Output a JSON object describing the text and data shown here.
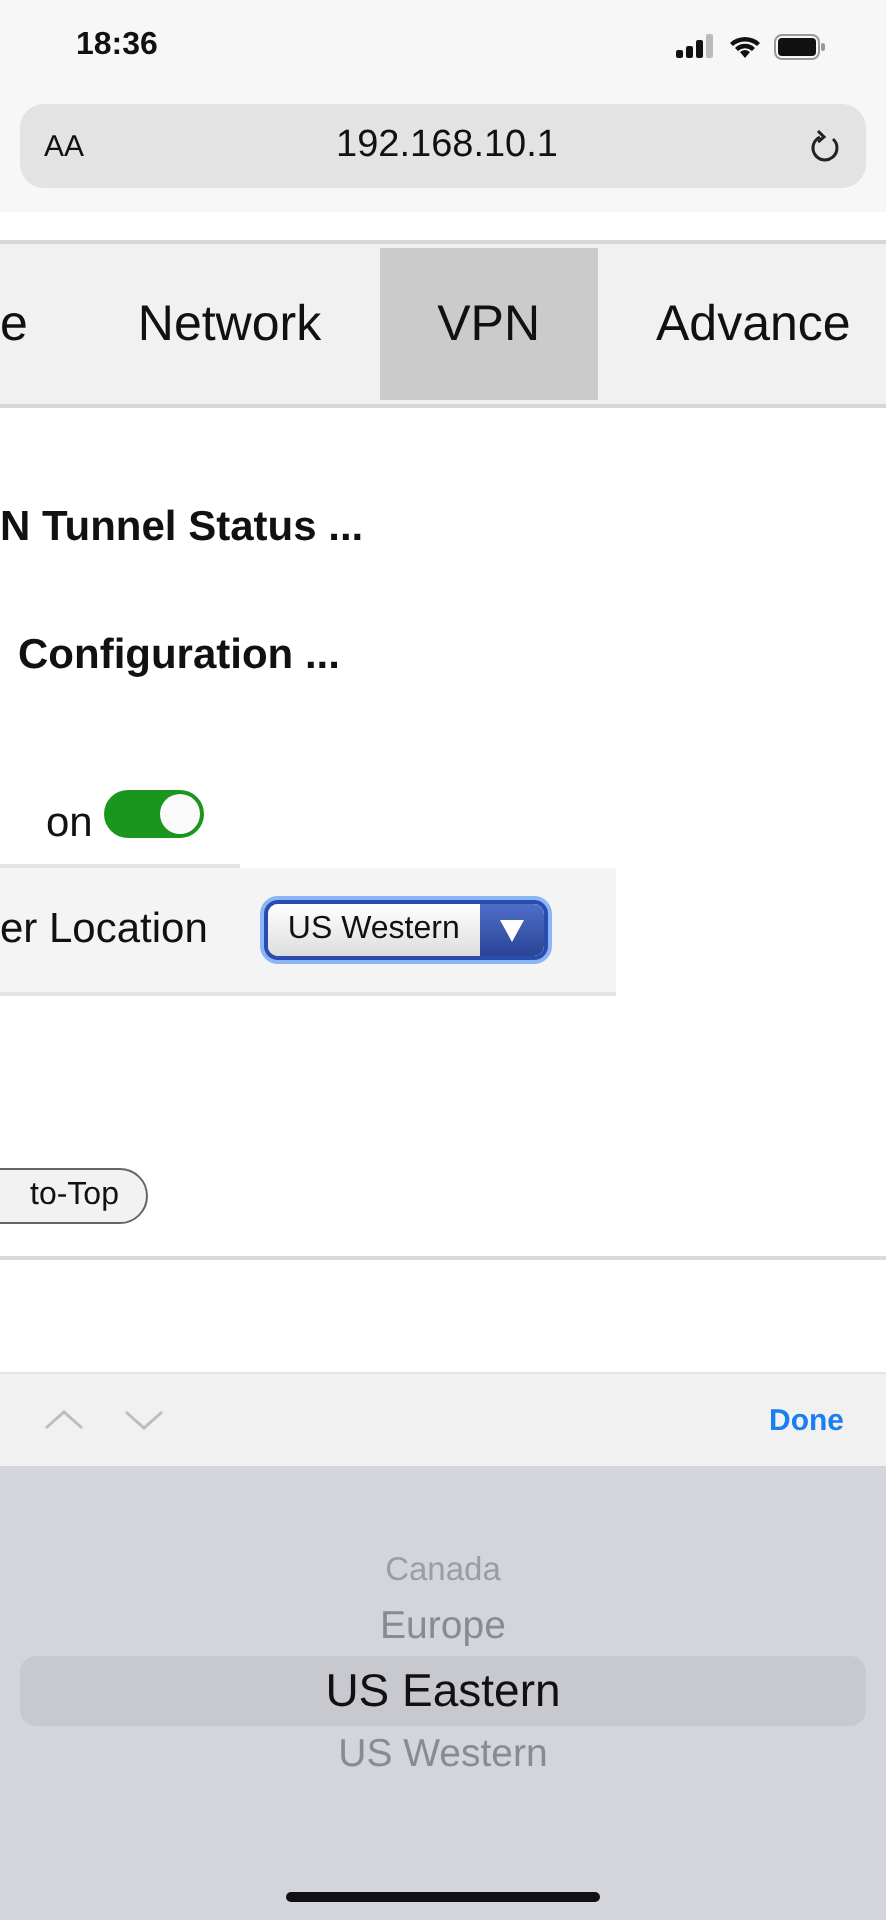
{
  "status_bar": {
    "time": "18:36"
  },
  "address_bar": {
    "text_size_button": "AA",
    "url": "192.168.10.1"
  },
  "tabs": [
    {
      "label": "e",
      "selected": false
    },
    {
      "label": "Network",
      "selected": false
    },
    {
      "label": "VPN",
      "selected": true
    },
    {
      "label": "Advance",
      "selected": false
    }
  ],
  "sections": [
    {
      "title": "N Tunnel Status ..."
    },
    {
      "title": "Configuration ..."
    }
  ],
  "vpn_switch": {
    "label": "on",
    "on": true
  },
  "server_location": {
    "label": "er Location",
    "value": "US Western"
  },
  "back_to_top_button": "to-Top",
  "picker_toolbar": {
    "previous_disabled": true,
    "next_disabled": true,
    "done": "Done"
  },
  "picker": {
    "options": [
      {
        "label": "Canada",
        "selected": false
      },
      {
        "label": "Europe",
        "selected": false
      },
      {
        "label": "US Eastern",
        "selected": true
      },
      {
        "label": "US Western",
        "selected": false
      }
    ]
  }
}
